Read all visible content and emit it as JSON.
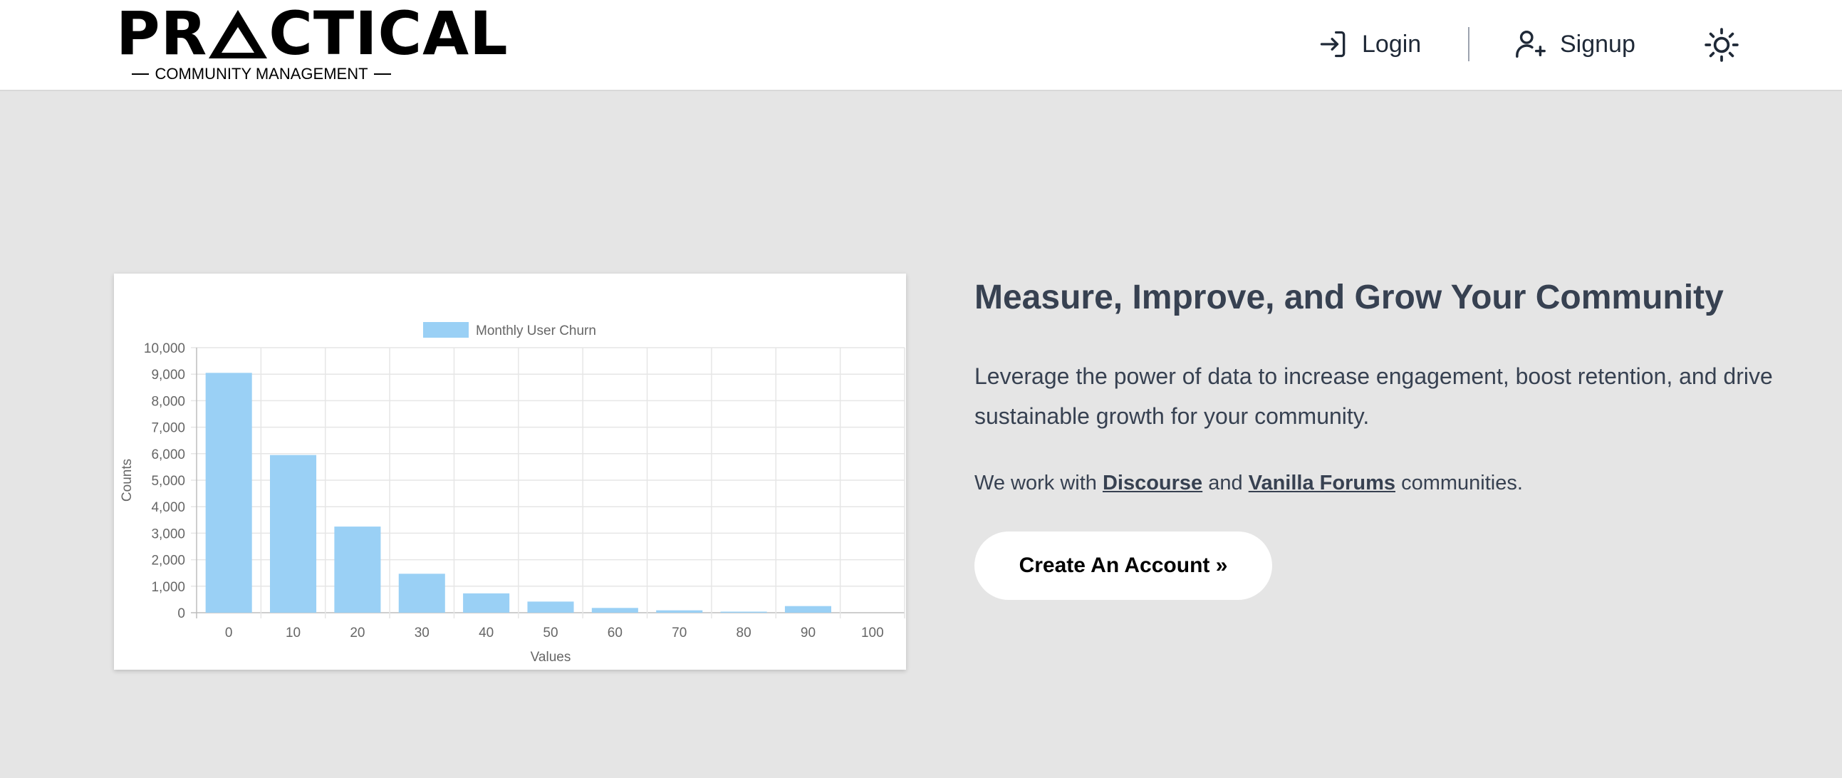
{
  "header": {
    "logo": {
      "word": "PRACTICAL",
      "word_left": "PR",
      "word_right": "CTICAL",
      "tagline": "COMMUNITY MANAGEMENT"
    },
    "nav": {
      "login_label": "Login",
      "signup_label": "Signup"
    },
    "icons": {
      "login": "login-icon",
      "signup": "user-plus-icon",
      "theme": "sun-icon"
    }
  },
  "hero": {
    "title": "Measure, Improve, and Grow Your Community",
    "description": "Leverage the power of data to increase engagement, boost retention, and drive sustainable growth for your community.",
    "partners_prefix": "We work with",
    "partner1": "Discourse",
    "partners_middle": "and",
    "partner2": "Vanilla Forums",
    "partners_suffix": "communities.",
    "cta_label": "Create An Account »"
  },
  "chart_data": {
    "type": "bar",
    "legend": "Monthly User Churn",
    "legend_position": "top",
    "xlabel": "Values",
    "ylabel": "Counts",
    "x_ticks": [
      "0",
      "10",
      "20",
      "30",
      "40",
      "50",
      "60",
      "70",
      "80",
      "90",
      "100"
    ],
    "values": [
      9050,
      5950,
      3250,
      1470,
      730,
      420,
      180,
      90,
      40,
      250,
      0
    ],
    "y_ticks": [
      "0",
      "1,000",
      "2,000",
      "3,000",
      "4,000",
      "5,000",
      "6,000",
      "7,000",
      "8,000",
      "9,000",
      "10,000"
    ],
    "ylim": [
      0,
      10000
    ],
    "grid": true,
    "bar_color": "#9ad0f5"
  },
  "colors": {
    "page_bg": "#e5e5e5",
    "text": "#374151",
    "bar": "#9ad0f5"
  }
}
